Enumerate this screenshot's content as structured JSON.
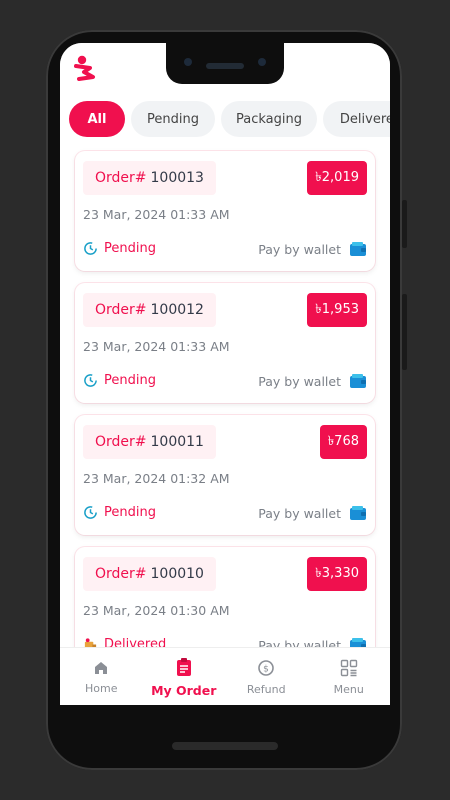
{
  "colors": {
    "accent": "#f0104e",
    "muted": "#7a7f87"
  },
  "tabs": [
    {
      "label": "All",
      "active": true
    },
    {
      "label": "Pending",
      "active": false
    },
    {
      "label": "Packaging",
      "active": false
    },
    {
      "label": "Delivered",
      "active": false
    }
  ],
  "orders": [
    {
      "order_prefix": "Order#",
      "order_no": "100013",
      "price": "৳2,019",
      "date": "23 Mar, 2024 01:33 AM",
      "status": "Pending",
      "status_icon": "clock-icon",
      "payment": "Pay by wallet",
      "payment_icon": "wallet-icon"
    },
    {
      "order_prefix": "Order#",
      "order_no": "100012",
      "price": "৳1,953",
      "date": "23 Mar, 2024 01:33 AM",
      "status": "Pending",
      "status_icon": "clock-icon",
      "payment": "Pay by wallet",
      "payment_icon": "wallet-icon"
    },
    {
      "order_prefix": "Order#",
      "order_no": "100011",
      "price": "৳768",
      "date": "23 Mar, 2024 01:32 AM",
      "status": "Pending",
      "status_icon": "clock-icon",
      "payment": "Pay by wallet",
      "payment_icon": "wallet-icon"
    },
    {
      "order_prefix": "Order#",
      "order_no": "100010",
      "price": "৳3,330",
      "date": "23 Mar, 2024 01:30 AM",
      "status": "Delivered",
      "status_icon": "delivery-icon",
      "payment": "Pay by wallet",
      "payment_icon": "wallet-icon"
    }
  ],
  "bottom_nav": [
    {
      "label": "Home",
      "icon": "home-icon",
      "active": false
    },
    {
      "label": "My Order",
      "icon": "clipboard-icon",
      "active": true
    },
    {
      "label": "Refund",
      "icon": "refund-icon",
      "active": false
    },
    {
      "label": "Menu",
      "icon": "menu-grid-icon",
      "active": false
    }
  ]
}
